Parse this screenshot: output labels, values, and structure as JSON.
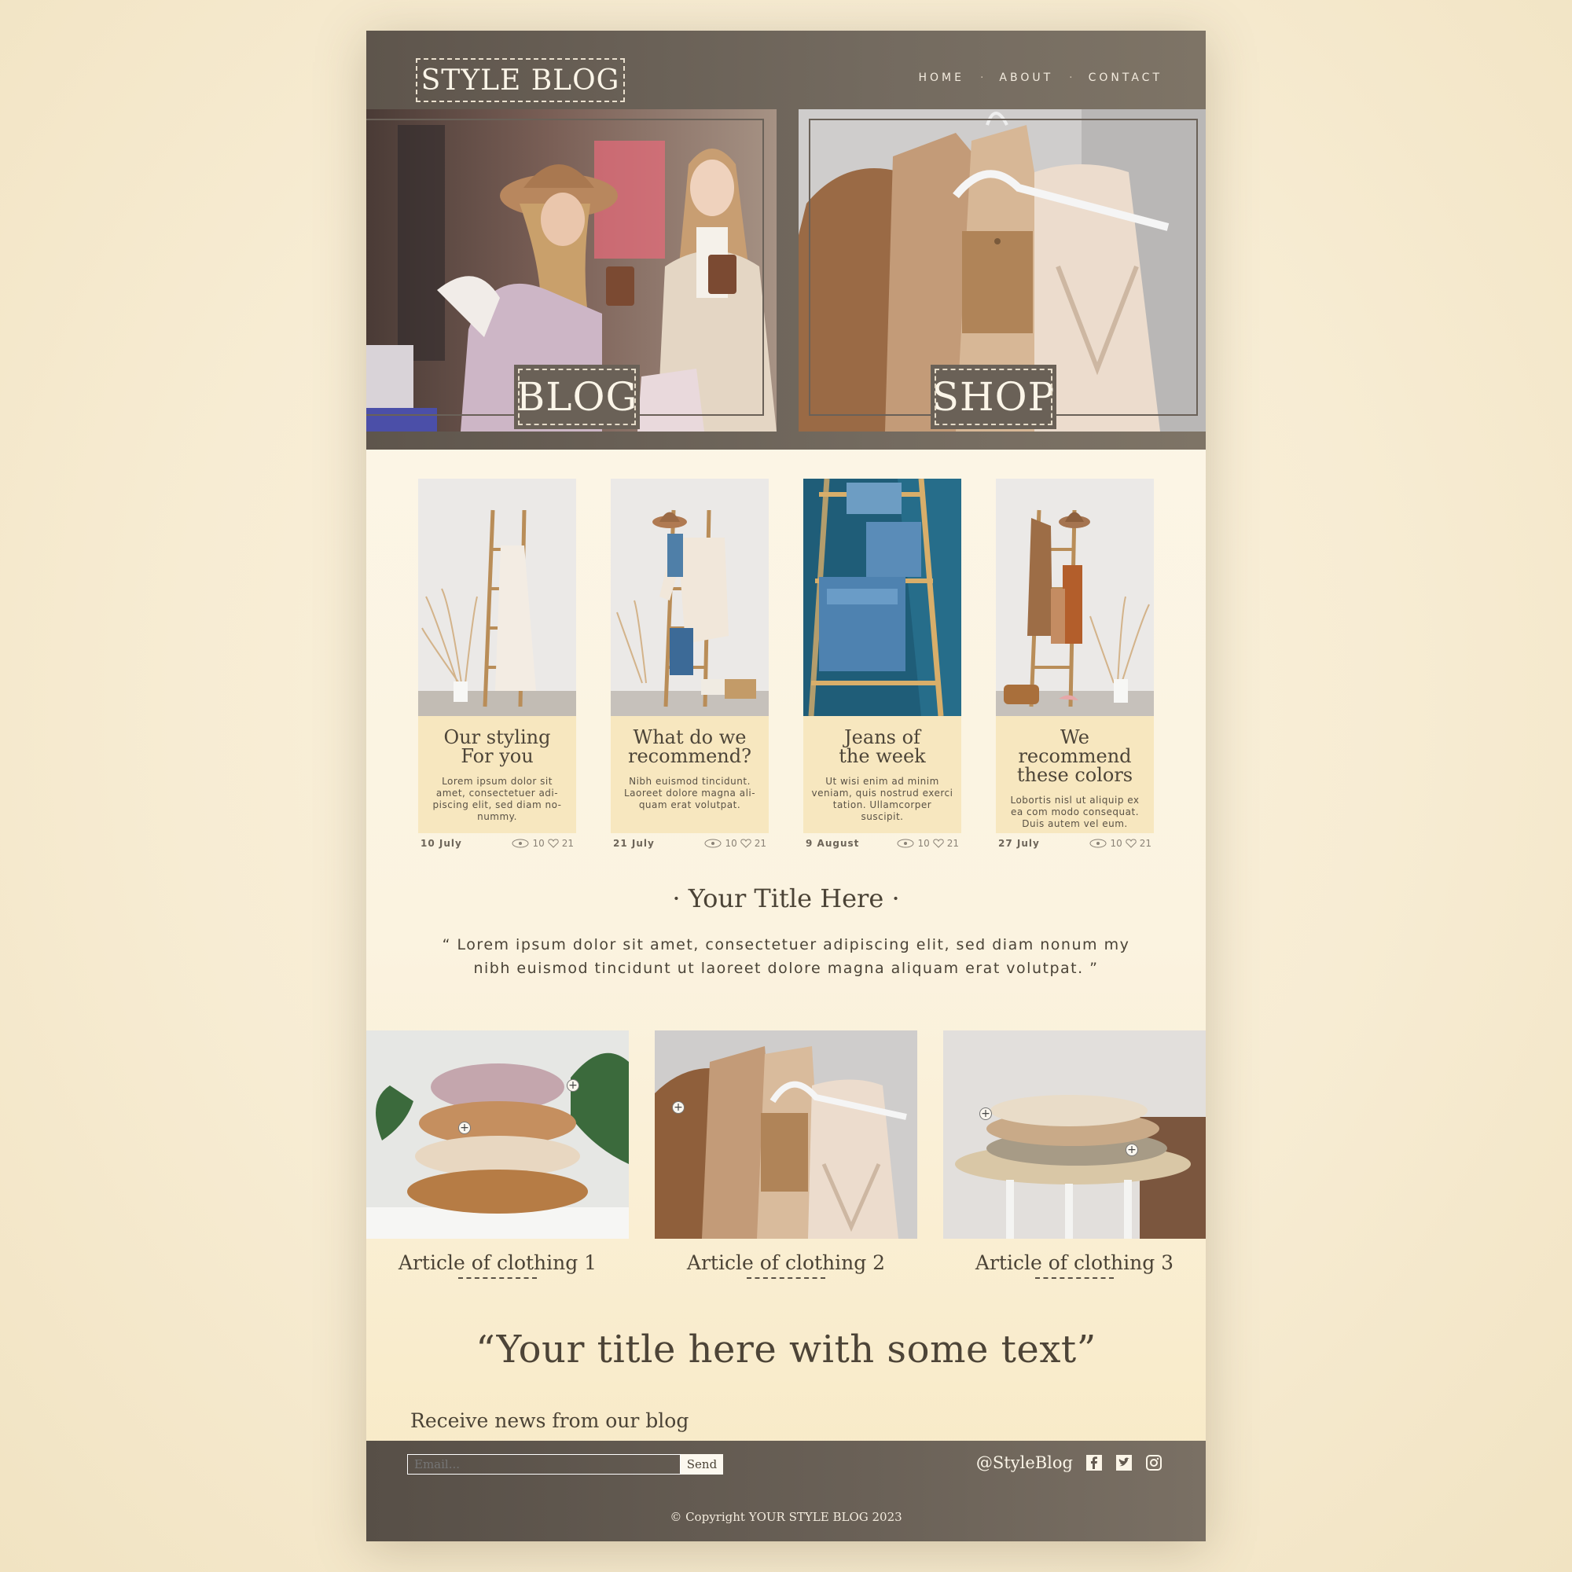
{
  "header": {
    "logo": "STYLE BLOG",
    "nav": {
      "home": "HOME",
      "about": "ABOUT",
      "contact": "CONTACT",
      "separator": "·"
    },
    "hero_blog_label": "BLOG",
    "hero_shop_label": "SHOP"
  },
  "cards": [
    {
      "title_line1": "Our styling",
      "title_line2": "For you",
      "text": "Lorem ipsum dolor sit amet, consectetuer adi-piscing elit, sed diam no-nummy.",
      "date": "10 July",
      "views": "10",
      "likes": "21"
    },
    {
      "title_line1": "What do we",
      "title_line2": "recommend?",
      "text": "Nibh euismod tincidunt. Laoreet dolore magna ali-quam erat volutpat.",
      "date": "21 July",
      "views": "10",
      "likes": "21"
    },
    {
      "title_line1": "Jeans of",
      "title_line2": "the week",
      "text": "Ut wisi enim ad minim veniam, quis nostrud exerci tation. Ullamcorper suscipit.",
      "date": "9 August",
      "views": "10",
      "likes": "21"
    },
    {
      "title_line1": "We recommend",
      "title_line2": "these colors",
      "text": "Lobortis nisl ut aliquip ex ea com modo consequat. Duis autem vel eum.",
      "date": "27 July",
      "views": "10",
      "likes": "21"
    }
  ],
  "section": {
    "title": "· Your Title Here ·",
    "quote": "“ Lorem ipsum dolor sit amet, consectetuer adipiscing elit, sed diam nonum my nibh euismod tincidunt ut laoreet dolore magna aliquam erat volutpat. ”"
  },
  "articles": [
    {
      "title": "Article of clothing 1"
    },
    {
      "title": "Article of clothing 2"
    },
    {
      "title": "Article of clothing 3"
    }
  ],
  "big_quote": "“Your title here with some text”",
  "newsletter": {
    "label": "Receive news from our blog",
    "email_placeholder": "Email...",
    "send": "Send"
  },
  "footer": {
    "handle": "@StyleBlog",
    "copyright": "© Copyright YOUR STYLE BLOG 2023"
  },
  "icons": [
    "eye-icon",
    "heart-icon",
    "plus-icon",
    "facebook-icon",
    "twitter-icon",
    "instagram-icon"
  ],
  "colors": {
    "header_bg": "#6a6157",
    "card_bg": "#f7e7bf",
    "text": "#4b4336"
  }
}
